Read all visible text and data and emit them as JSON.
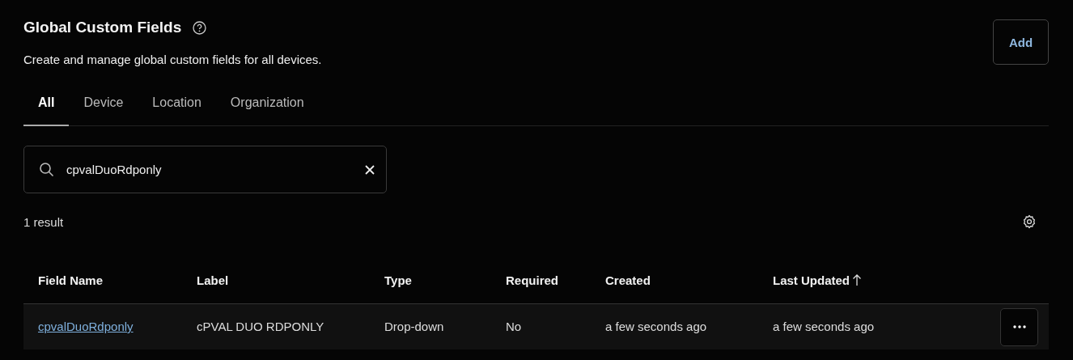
{
  "header": {
    "title": "Global Custom Fields",
    "subtitle": "Create and manage global custom fields for all devices.",
    "add_button": "Add"
  },
  "tabs": [
    {
      "label": "All",
      "selected": true
    },
    {
      "label": "Device",
      "selected": false
    },
    {
      "label": "Location",
      "selected": false
    },
    {
      "label": "Organization",
      "selected": false
    }
  ],
  "search": {
    "value": "cpvalDuoRdponly"
  },
  "result_count": "1 result",
  "table": {
    "columns": [
      {
        "label": "Field Name",
        "sorted": false
      },
      {
        "label": "Label",
        "sorted": false
      },
      {
        "label": "Type",
        "sorted": false
      },
      {
        "label": "Required",
        "sorted": false
      },
      {
        "label": "Created",
        "sorted": false
      },
      {
        "label": "Last Updated",
        "sorted": true
      }
    ],
    "rows": [
      {
        "field_name": "cpvalDuoRdponly",
        "label": "cPVAL DUO RDPONLY",
        "type": "Drop-down",
        "required": "No",
        "created": "a few seconds ago",
        "last_updated": "a few seconds ago"
      }
    ]
  }
}
